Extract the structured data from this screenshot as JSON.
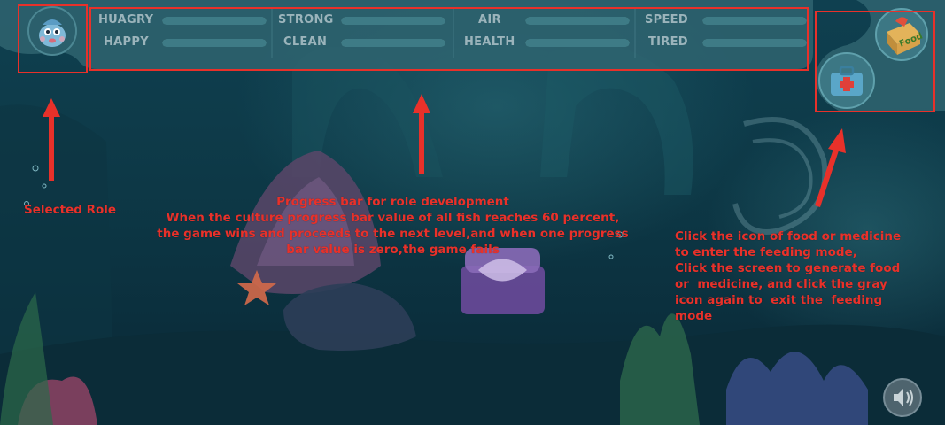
{
  "hud": {
    "stats": [
      {
        "label": "HUAGRY",
        "level": 1.0
      },
      {
        "label": "HAPPY",
        "level": 1.0
      },
      {
        "label": "STRONG",
        "level": 1.0
      },
      {
        "label": "CLEAN",
        "level": 1.0
      },
      {
        "label": "AIR",
        "level": 1.0
      },
      {
        "label": "HEALTH",
        "level": 1.0
      },
      {
        "label": "SPEED",
        "level": 1.0
      },
      {
        "label": "TIRED",
        "level": 1.0
      }
    ],
    "food_icon_text": "Food"
  },
  "annotations": {
    "selected_role": "Selected Role",
    "progress_note": "Progress bar for role development\nWhen the culture progress bar value of all fish reaches 60 percent,\nthe game wins and proceeds to the next level,and when one progress\nbar value is zero,the game fails",
    "feeding_note": "Click the icon of food or medicine\nto enter the feeding mode,\nClick the screen to generate food\nor  medicine, and click the gray\nicon again to  exit the  feeding\nmode"
  },
  "colors": {
    "annotation_red": "#e8312a",
    "hud_panel": "#2f6470",
    "hud_label": "#9bb4bb",
    "water_top": "#0f4050",
    "water_bottom": "#0a2733"
  },
  "icons": [
    "fish-avatar-icon",
    "food-box-icon",
    "medicine-kit-icon",
    "sound-speaker-icon",
    "up-arrow-icon"
  ]
}
